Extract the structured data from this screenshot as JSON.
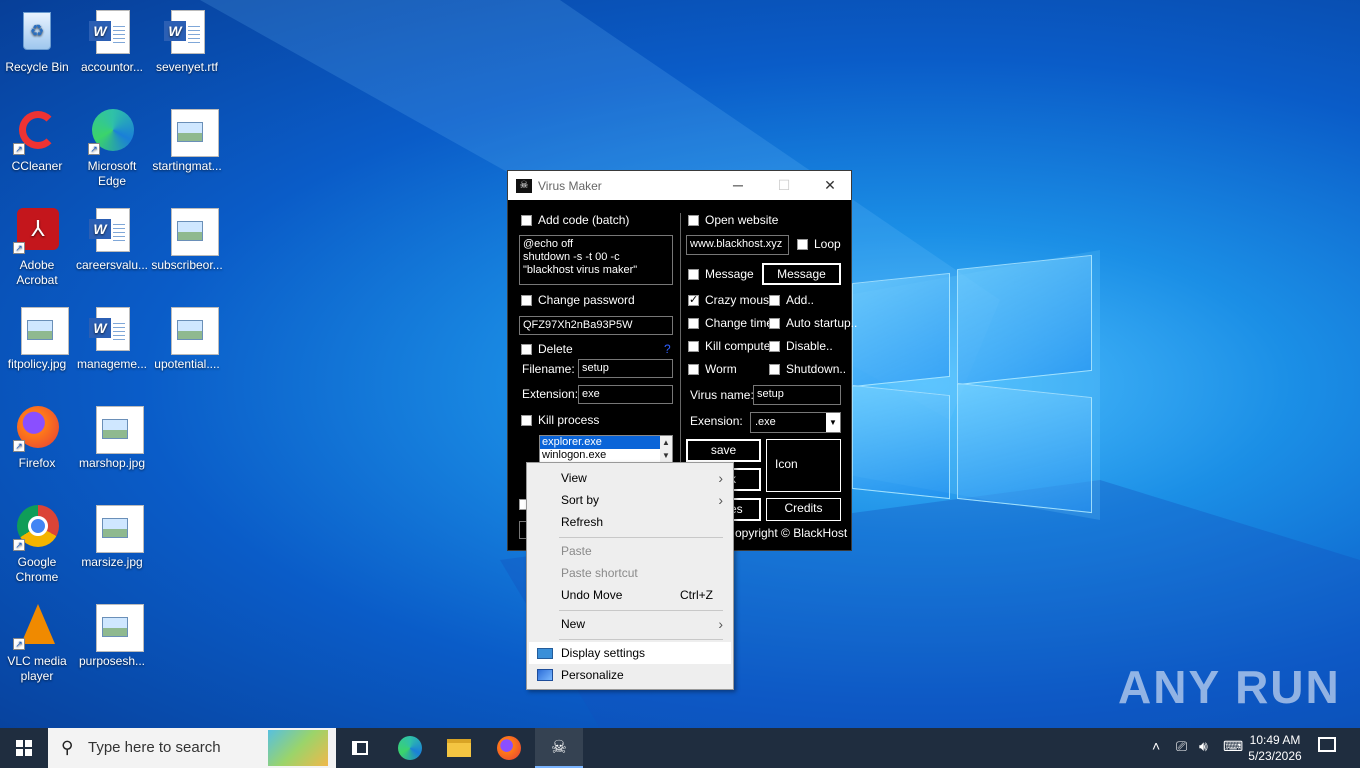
{
  "desktop": {
    "icons": [
      {
        "label": "Recycle Bin",
        "icon": "recycle-bin-icon"
      },
      {
        "label": "accountor...",
        "icon": "word-document-icon"
      },
      {
        "label": "sevenyet.rtf",
        "icon": "word-document-icon"
      },
      {
        "label": "CCleaner",
        "icon": "ccleaner-icon"
      },
      {
        "label": "Microsoft Edge",
        "icon": "edge-icon"
      },
      {
        "label": "startingmat...",
        "icon": "image-file-icon"
      },
      {
        "label": "Adobe Acrobat",
        "icon": "acrobat-icon"
      },
      {
        "label": "careersvalu...",
        "icon": "word-document-icon"
      },
      {
        "label": "subscribeor...",
        "icon": "image-file-icon"
      },
      {
        "label": "fitpolicy.jpg",
        "icon": "image-file-icon"
      },
      {
        "label": "manageme...",
        "icon": "word-document-icon"
      },
      {
        "label": "upotential....",
        "icon": "image-file-icon"
      },
      {
        "label": "Firefox",
        "icon": "firefox-icon"
      },
      {
        "label": "marshop.jpg",
        "icon": "image-file-icon"
      },
      {
        "label": "Google Chrome",
        "icon": "chrome-icon"
      },
      {
        "label": "marsize.jpg",
        "icon": "image-file-icon"
      },
      {
        "label": "VLC media player",
        "icon": "vlc-icon"
      },
      {
        "label": "purposesh...",
        "icon": "image-file-icon"
      }
    ]
  },
  "window": {
    "title": "Virus Maker",
    "add_code_label": "Add code (batch)",
    "batch_code": "@echo off\nshutdown -s -t 00 -c \"blackhost virus maker\"",
    "change_password_label": "Change password",
    "password_value": "QFZ97Xh2nBa93P5W",
    "delete_label": "Delete",
    "delete_help": "?",
    "filename_label": "Filename:",
    "filename_value": "setup",
    "extension_label": "Extension:",
    "extension_value": "exe",
    "kill_process_label": "Kill process",
    "processes": [
      "explorer.exe",
      "winlogon.exe"
    ],
    "open_website_label": "Open website",
    "website_value": "www.blackhost.xyz",
    "loop_label": "Loop",
    "message_label": "Message",
    "message_button": "Message",
    "crazy_mouse_label": "Crazy mouse",
    "add_label": "Add..",
    "change_time_label": "Change time",
    "auto_startup_label": "Auto startup..",
    "kill_computer_label": "Kill computer",
    "disable_label": "Disable..",
    "worm_label": "Worm",
    "shutdown_label": "Shutdown..",
    "virus_name_label": "Virus name:",
    "virus_name_value": "setup",
    "extension2_label": "Exension:",
    "extension2_value": ".exe",
    "save_button": "save",
    "icon_button": "Icon",
    "partial_button_1": "k",
    "partial_button_2": "es",
    "credits_button": "Credits",
    "copyright": "opyright © BlackHost"
  },
  "context_menu": {
    "items": [
      {
        "label": "View",
        "submenu": true
      },
      {
        "label": "Sort by",
        "submenu": true
      },
      {
        "label": "Refresh"
      },
      {
        "label": "Paste",
        "disabled": true
      },
      {
        "label": "Paste shortcut",
        "disabled": true
      },
      {
        "label": "Undo Move",
        "shortcut": "Ctrl+Z"
      },
      {
        "label": "New",
        "submenu": true
      },
      {
        "label": "Display settings",
        "icon": "display-icon"
      },
      {
        "label": "Personalize",
        "icon": "personalize-icon"
      }
    ]
  },
  "taskbar": {
    "search_placeholder": "Type here to search",
    "time": "10:49 AM",
    "date": "5/23/2026"
  },
  "watermark": "ANY RUN"
}
